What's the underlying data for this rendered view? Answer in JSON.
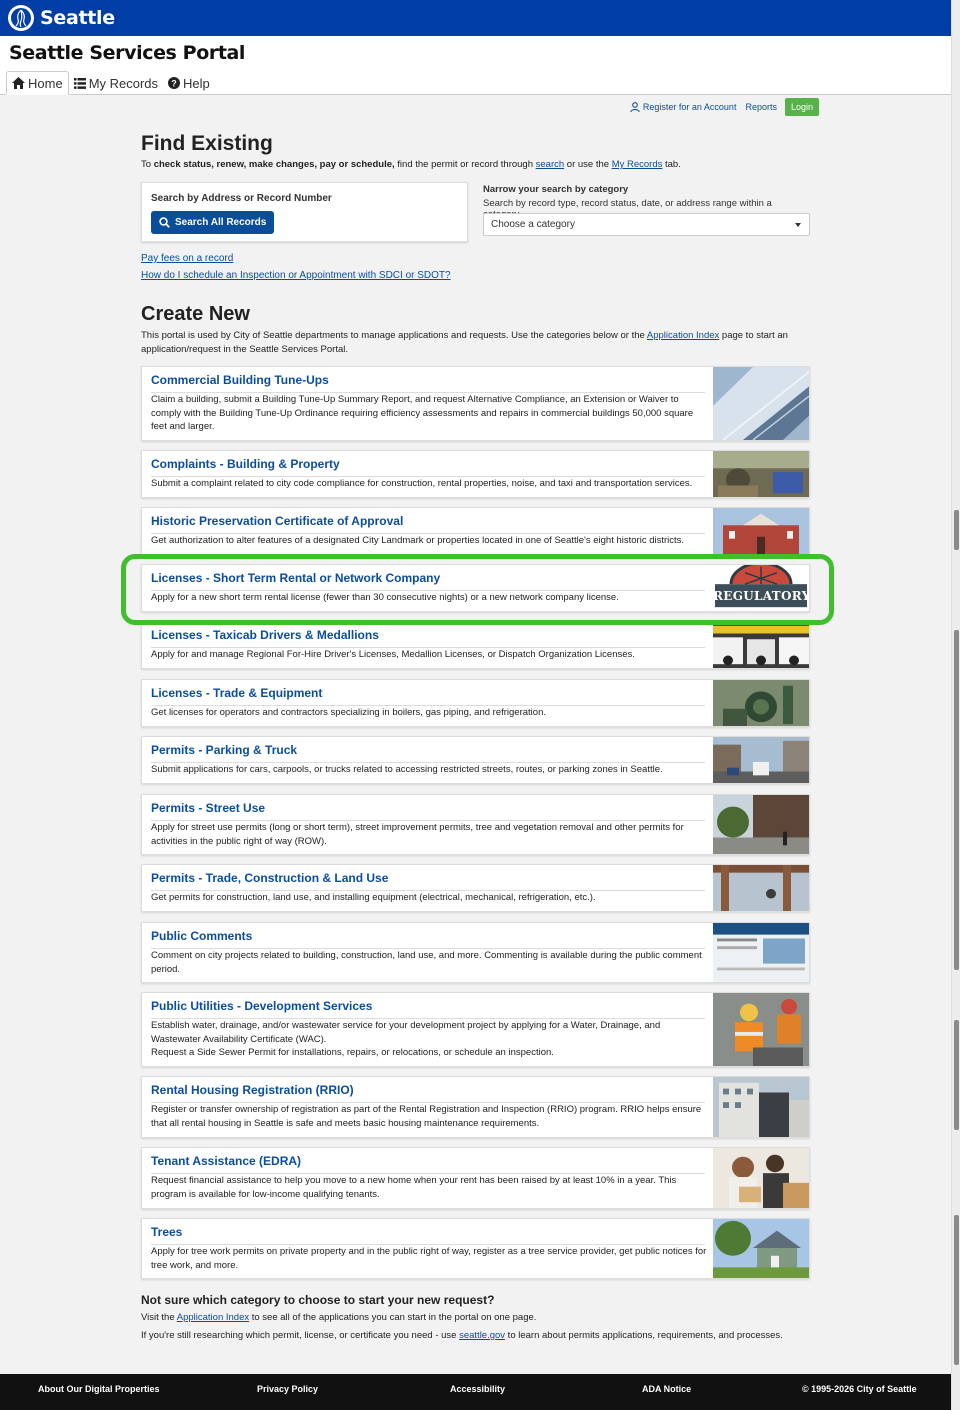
{
  "brand": {
    "name": "Seattle"
  },
  "header": {
    "portal_title": "Seattle Services Portal",
    "tabs": [
      {
        "label": "Home",
        "icon": "home-icon"
      },
      {
        "label": "My Records",
        "icon": "list-icon"
      },
      {
        "label": "Help",
        "icon": "help-icon"
      }
    ]
  },
  "account": {
    "register": "Register for an Account",
    "reports": "Reports",
    "login": "Login"
  },
  "find": {
    "heading": "Find Existing",
    "desc_prefix": "To ",
    "desc_bold": "check status, renew, make changes, pay or schedule,",
    "desc_mid": " find the permit or record through ",
    "desc_link1": "search",
    "desc_mid2": " or use the ",
    "desc_link2": "My Records",
    "desc_suffix": " tab.",
    "search_label": "Search by Address or Record Number",
    "search_button": "Search All Records",
    "narrow_label": "Narrow your search by category",
    "narrow_desc": "Search by record type, record status, date, or address range within a category.",
    "select_value": "Choose a category",
    "link_pay": "Pay fees on a record",
    "link_inspection": "How do I schedule an Inspection or Appointment with SDCI or SDOT?"
  },
  "create": {
    "heading": "Create New",
    "desc_prefix": "This portal is used by City of Seattle departments to manage applications and requests. Use the categories below or the ",
    "desc_link": "Application Index",
    "desc_suffix": " page to start an application/request in the Seattle Services Portal.",
    "cards": [
      {
        "title": "Commercial Building Tune-Ups",
        "desc": "Claim a building, submit a Building Tune-Up Summary Report, and request Alternative Compliance, an Extension or Waiver to comply with the Building Tune-Up Ordinance requiring efficiency assessments and repairs in commercial buildings 50,000 square feet and larger."
      },
      {
        "title": "Complaints - Building & Property",
        "desc": "Submit a complaint related to city code compliance for construction, rental properties, noise, and taxi and transportation services."
      },
      {
        "title": "Historic Preservation Certificate of Approval",
        "desc": "Get authorization to alter features of a designated City Landmark or properties located in one of Seattle's eight historic districts."
      },
      {
        "title": "Licenses - Short Term Rental or Network Company",
        "desc": "Apply for a new short term rental license (fewer than 30 consecutive nights) or a new network company license.",
        "badge": "REGULATORY"
      },
      {
        "title": "Licenses - Taxicab Drivers & Medallions",
        "desc": "Apply for and manage Regional For-Hire Driver's Licenses, Medallion Licenses, or Dispatch Organization Licenses."
      },
      {
        "title": "Licenses - Trade & Equipment",
        "desc": "Get licenses for operators and contractors specializing in boilers, gas piping, and refrigeration."
      },
      {
        "title": "Permits - Parking & Truck",
        "desc": "Submit applications for cars, carpools, or trucks related to accessing restricted streets, routes, or parking zones in Seattle."
      },
      {
        "title": "Permits - Street Use",
        "desc": "Apply for street use permits (long or short term), street improvement permits, tree and vegetation removal and other permits for activities in the public right of way (ROW)."
      },
      {
        "title": "Permits - Trade, Construction & Land Use",
        "desc": "Get permits for construction, land use, and installing equipment (electrical, mechanical, refrigeration, etc.)."
      },
      {
        "title": "Public Comments",
        "desc": "Comment on city projects related to building, construction, land use, and more. Commenting is available during the public comment period."
      },
      {
        "title": "Public Utilities - Development Services",
        "desc": "Establish water, drainage, and/or wastewater service for your development project by applying for a Water, Drainage, and Wastewater Availability Certificate (WAC).",
        "desc2": "Request a Side Sewer Permit for installations, repairs, or relocations, or schedule an inspection."
      },
      {
        "title": "Rental Housing Registration (RRIO)",
        "desc": "Register or transfer ownership of registration as part of the Rental Registration and Inspection (RRIO) program. RRIO helps ensure that all rental housing in Seattle is safe and meets basic housing maintenance requirements."
      },
      {
        "title": "Tenant Assistance (EDRA)",
        "desc": "Request financial assistance to help you move to a new home when your rent has been raised by at least 10% in a year. This program is available for low-income qualifying tenants."
      },
      {
        "title": "Trees",
        "desc": "Apply for tree work permits on private property and in the public right of way, register as a tree service provider, get public notices for tree work, and more."
      }
    ]
  },
  "bottom": {
    "question": "Not sure which category to choose to start your new request?",
    "l1_prefix": "Visit the ",
    "l1_link": "Application Index",
    "l1_suffix": " to see all of the applications you can start in the portal on one page.",
    "l2_prefix": "If you're still researching which permit, license, or certificate you need - use ",
    "l2_link": "seattle.gov",
    "l2_suffix": " to learn about permits applications, requirements, and processes."
  },
  "footer": {
    "about": "About Our Digital Properties",
    "privacy": "Privacy Policy",
    "accessibility": "Accessibility",
    "ada": "ADA Notice",
    "copyright": "© 1995-2026 City of Seattle"
  },
  "colors": {
    "brand_blue": "#003da5",
    "link_blue": "#0a4d9b",
    "login_green": "#58b24a",
    "highlight_green": "#3fbf2c"
  }
}
